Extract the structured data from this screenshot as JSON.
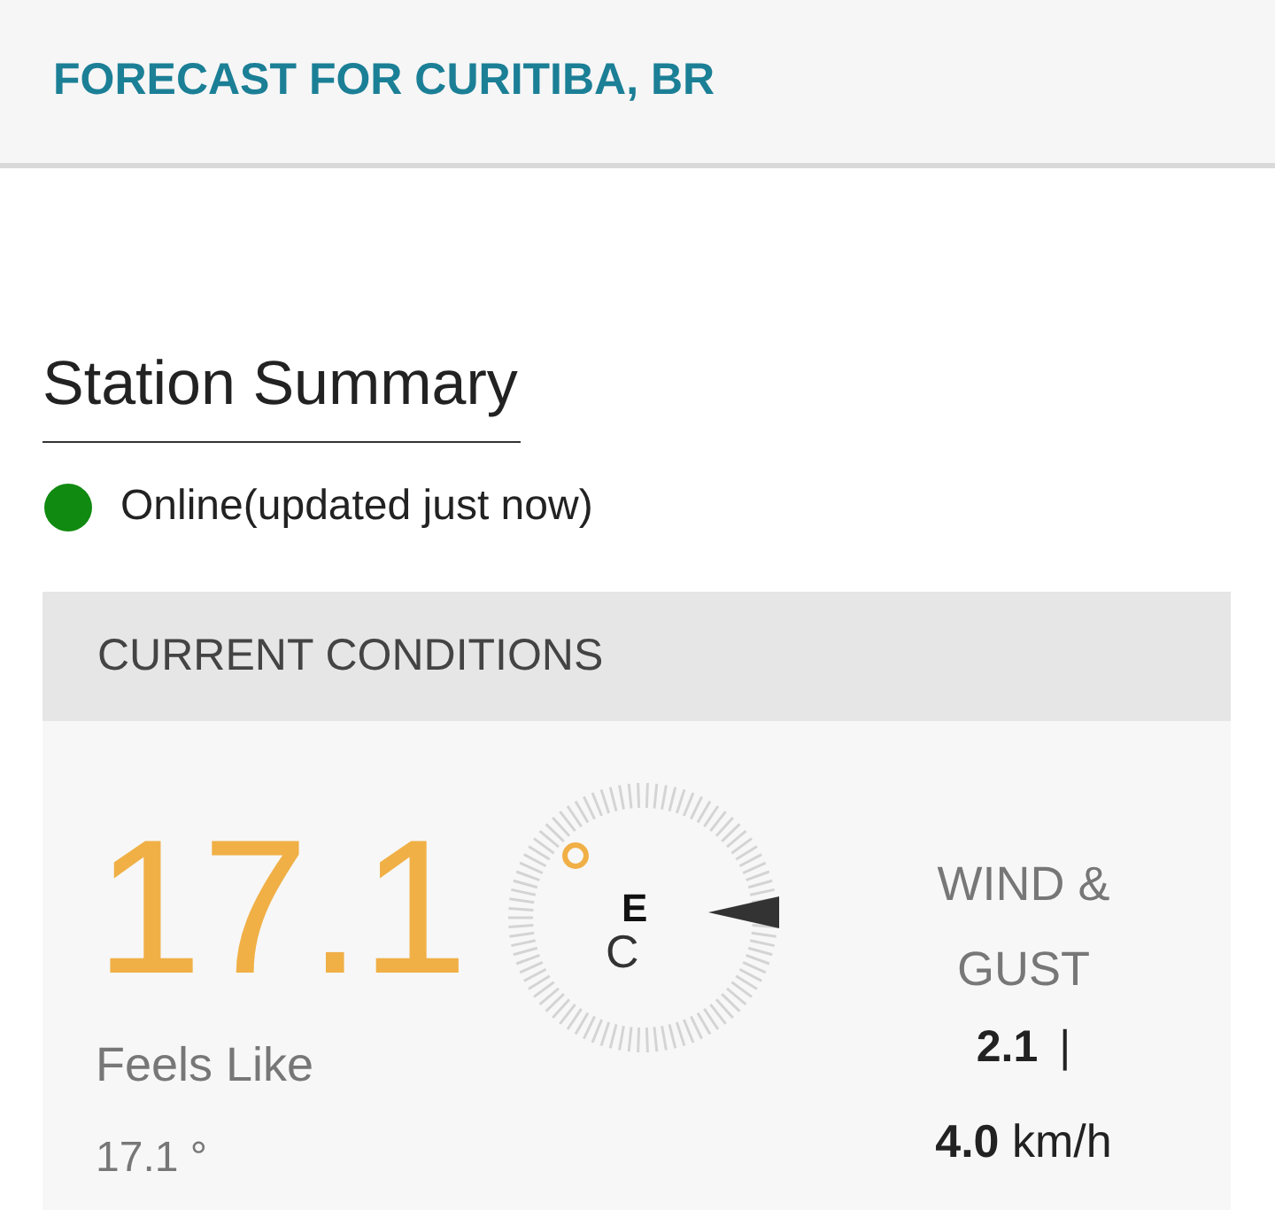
{
  "header": {
    "title": "FORECAST FOR CURITIBA, BR"
  },
  "station_summary": {
    "heading": "Station Summary",
    "status": {
      "online": true,
      "text": "Online(updated just now)"
    }
  },
  "current_conditions": {
    "heading": "CURRENT CONDITIONS",
    "temperature": "17.1",
    "unit": "C",
    "wind_direction": "E",
    "feels_like": {
      "label": "Feels Like",
      "value": "17.1 °"
    },
    "wind": {
      "label": "WIND & GUST",
      "speed": "2.1",
      "separator": "|",
      "gust": "4.0",
      "unit": "km/h"
    }
  }
}
